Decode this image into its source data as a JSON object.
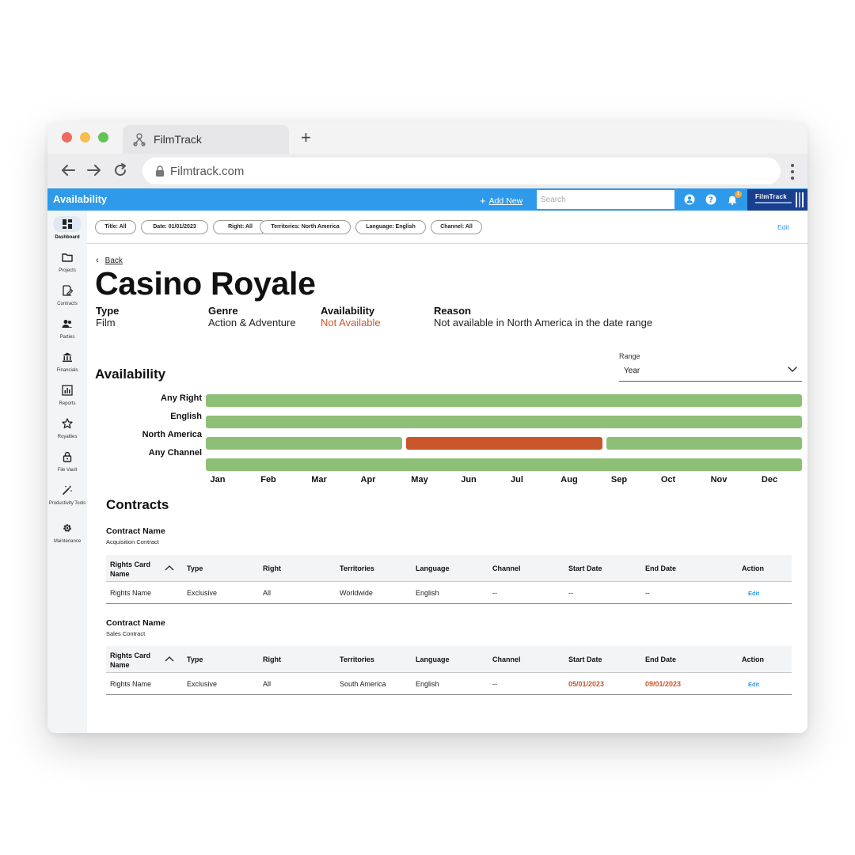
{
  "browser": {
    "tab_title": "FilmTrack",
    "new_tab": "+",
    "url": "Filmtrack.com"
  },
  "app": {
    "header_title": "Availability",
    "add_new": "Add New",
    "add_new_icon": "+",
    "search_placeholder": "Search",
    "notification_count": "1",
    "logo_text": "FilmTrack"
  },
  "sidebar": {
    "items": [
      {
        "label": "Dashboard",
        "icon": "dashboard-icon"
      },
      {
        "label": "Projects",
        "icon": "folder-icon"
      },
      {
        "label": "Contracts",
        "icon": "contract-edit-icon"
      },
      {
        "label": "Parties",
        "icon": "people-icon"
      },
      {
        "label": "Financials",
        "icon": "bank-icon"
      },
      {
        "label": "Reports",
        "icon": "bar-chart-icon"
      },
      {
        "label": "Royalties",
        "icon": "star-badge-icon"
      },
      {
        "label": "File Vault",
        "icon": "lock-icon"
      },
      {
        "label": "Productivity Tools",
        "icon": "magic-wand-icon"
      },
      {
        "label": "Maintenance",
        "icon": "gear-icon"
      }
    ]
  },
  "filters": {
    "chips": [
      "Title: All",
      "Date: 01/01/2023",
      "Right: All",
      "Territories: North America",
      "Language: English",
      "Channel: All"
    ],
    "edit_label": "Edit"
  },
  "detail": {
    "back_label": "Back",
    "title": "Casino Royale",
    "type_label": "Type",
    "type_value": "Film",
    "genre_label": "Genre",
    "genre_value": "Action & Adventure",
    "availability_label": "Availability",
    "availability_value": "Not Available",
    "reason_label": "Reason",
    "reason_value": "Not available in North America in the date range"
  },
  "availability": {
    "heading": "Availability",
    "range_label": "Range",
    "range_value": "Year",
    "rows": [
      "Any Right",
      "English",
      "North America",
      "Any Channel"
    ],
    "months": [
      "Jan",
      "Feb",
      "Mar",
      "Apr",
      "May",
      "Jun",
      "Jul",
      "Aug",
      "Sep",
      "Oct",
      "Nov",
      "Dec"
    ],
    "colors": {
      "available": "#8dbf76",
      "unavailable": "#c9562a"
    }
  },
  "contracts": {
    "heading": "Contracts",
    "columns": [
      "Rights Card Name",
      "Type",
      "Right",
      "Territories",
      "Language",
      "Channel",
      "Start Date",
      "End Date",
      "Action"
    ],
    "items": [
      {
        "name_label": "Contract Name",
        "name_value": "Acquisition Contract",
        "row": {
          "rights": "Rights Name",
          "type": "Exclusive",
          "right": "All",
          "territories": "Worldwide",
          "language": "English",
          "channel": "--",
          "start": "--",
          "end": "--",
          "action": "Edit"
        }
      },
      {
        "name_label": "Contract Name",
        "name_value": "Sales Contract",
        "row": {
          "rights": "Rights Name",
          "type": "Exclusive",
          "right": "All",
          "territories": "South America",
          "language": "English",
          "channel": "--",
          "start": "05/01/2023",
          "end": "09/01/2023",
          "action": "Edit"
        }
      }
    ]
  },
  "colors": {
    "accent": "#2f9ae9",
    "alert": "#c8572b",
    "logo_bg": "#1b3f8f"
  }
}
